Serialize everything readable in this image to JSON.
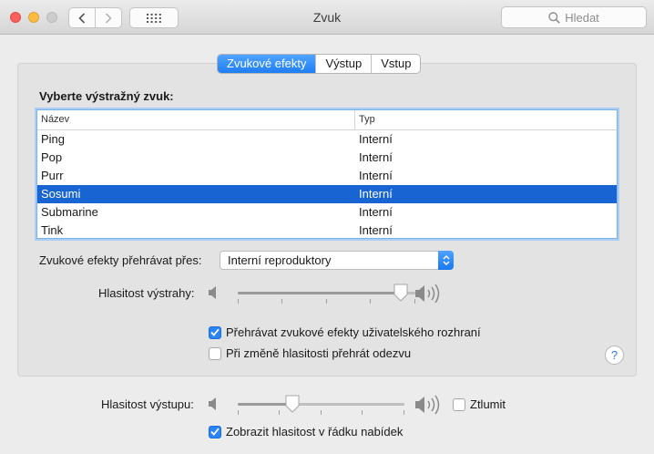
{
  "window": {
    "title": "Zvuk",
    "search_placeholder": "Hledat"
  },
  "tabs": [
    {
      "label": "Zvukové efekty",
      "active": true
    },
    {
      "label": "Výstup",
      "active": false
    },
    {
      "label": "Vstup",
      "active": false
    }
  ],
  "alert": {
    "section_label": "Vyberte výstražný zvuk:",
    "columns": {
      "name": "Název",
      "type": "Typ"
    },
    "rows": [
      {
        "name": "Ping",
        "type": "Interní",
        "selected": false
      },
      {
        "name": "Pop",
        "type": "Interní",
        "selected": false
      },
      {
        "name": "Purr",
        "type": "Interní",
        "selected": false
      },
      {
        "name": "Sosumi",
        "type": "Interní",
        "selected": true
      },
      {
        "name": "Submarine",
        "type": "Interní",
        "selected": false
      },
      {
        "name": "Tink",
        "type": "Interní",
        "selected": false
      }
    ]
  },
  "play_through": {
    "label": "Zvukové efekty přehrávat přes:",
    "value": "Interní reproduktory"
  },
  "alert_volume": {
    "label": "Hlasitost výstrahy:",
    "level": 0.92
  },
  "checks": {
    "ui_effects": {
      "label": "Přehrávat zvukové efekty uživatelského rozhraní",
      "checked": true
    },
    "volume_feedback": {
      "label": "Při změně hlasitosti přehrát odezvu",
      "checked": false
    }
  },
  "output_volume": {
    "label": "Hlasitost výstupu:",
    "level": 0.33,
    "mute_label": "Ztlumit",
    "muted": false,
    "show_in_menu_label": "Zobrazit hlasitost v řádku nabídek",
    "show_in_menu": true
  },
  "help_label": "?",
  "colors": {
    "accent": "#1764d2",
    "checkbox_on": "#2a84f7"
  }
}
